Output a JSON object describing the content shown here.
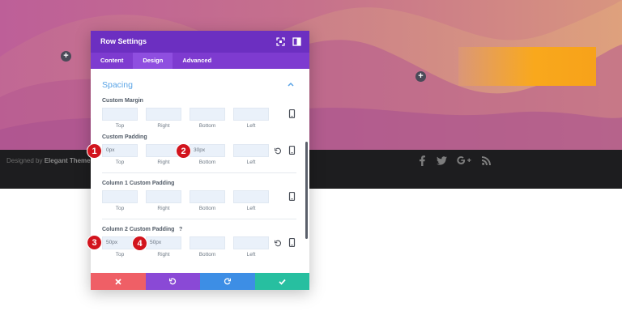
{
  "footer": {
    "credit_prefix": "Designed by",
    "credit_brand": "Elegant Themes",
    "social_icons": [
      "facebook-icon",
      "twitter-icon",
      "google-plus-icon",
      "rss-icon"
    ]
  },
  "canvas": {
    "add_buttons": [
      "+",
      "+"
    ],
    "colors": {
      "hero_top": "#c2668f",
      "hero_bottom": "#a85294",
      "accent_box": "#f7a21a"
    }
  },
  "modal": {
    "title": "Row Settings",
    "tabs": [
      {
        "label": "Content",
        "active": false
      },
      {
        "label": "Design",
        "active": true
      },
      {
        "label": "Advanced",
        "active": false
      }
    ],
    "section_title": "Spacing",
    "side_labels": [
      "Top",
      "Right",
      "Bottom",
      "Left"
    ],
    "groups": {
      "custom_margin": {
        "label": "Custom Margin",
        "values": [
          "",
          "",
          "",
          ""
        ]
      },
      "custom_padding": {
        "label": "Custom Padding",
        "values": [
          "0px",
          "",
          "30px",
          ""
        ]
      },
      "column1_padding": {
        "label": "Column 1 Custom Padding",
        "values": [
          "",
          "",
          "",
          ""
        ]
      },
      "column2_padding": {
        "label": "Column 2 Custom Padding",
        "values": [
          "50px",
          "50px",
          "",
          ""
        ]
      }
    },
    "help_symbol": "?",
    "buttons": {
      "cancel": "cancel-icon",
      "undo": "undo-icon",
      "redo": "redo-icon",
      "save": "check-icon"
    },
    "colors": {
      "header": "#6c2fc1",
      "tabs": "#7e3bd0",
      "section_title": "#5aa4e6",
      "cancel": "#ef5f66",
      "undo": "#8a49d6",
      "redo": "#3d8ee5",
      "save": "#27bfa0"
    }
  },
  "callouts": [
    "1",
    "2",
    "3",
    "4"
  ]
}
